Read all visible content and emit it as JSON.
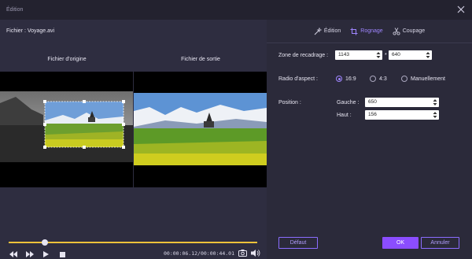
{
  "window": {
    "title": "Édition"
  },
  "file": {
    "label": "Fichier : Voyage.avi"
  },
  "panes": {
    "original": "Fichier d'origine",
    "output": "Fichier de sortie"
  },
  "playback": {
    "progress": 0.145,
    "time": "00:00:06.12/00:00:44.01"
  },
  "tabs": [
    {
      "label": "Édition",
      "icon": "magic-wand-icon",
      "active": false
    },
    {
      "label": "Rognage",
      "icon": "crop-icon",
      "active": true
    },
    {
      "label": "Coupage",
      "icon": "scissors-icon",
      "active": false
    }
  ],
  "crop": {
    "zone_label": "Zone de recadrage :",
    "width": "1143",
    "separator": "*",
    "height": "640",
    "aspect_label": "Radio d'aspect :",
    "aspect_options": [
      "16:9",
      "4:3",
      "Manuellement"
    ],
    "aspect_selected": "16:9",
    "position_label": "Position :",
    "left_label": "Gauche :",
    "left_value": "650",
    "top_label": "Haut :",
    "top_value": "156"
  },
  "buttons": {
    "default": "Défaut",
    "ok": "OK",
    "cancel": "Annuler"
  },
  "colors": {
    "accent": "#8b4dff",
    "progress": "#f0c23a",
    "panel": "#2b2a3a"
  }
}
